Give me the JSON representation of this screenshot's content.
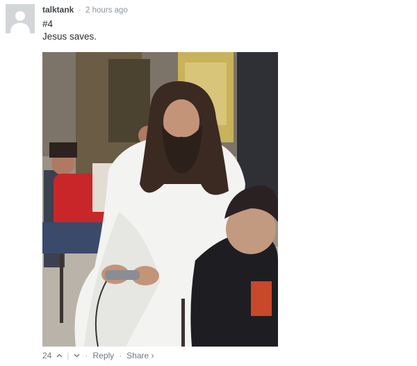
{
  "comment": {
    "author": "talktank",
    "separator": "·",
    "timestamp": "2 hours ago",
    "lines": [
      "#4",
      "Jesus saves."
    ],
    "image_alt_icon": "photo"
  },
  "footer": {
    "vote_count": "24",
    "upvote_icon": "chevron-up-icon",
    "downvote_icon": "chevron-down-icon",
    "pipe": "|",
    "dot": "·",
    "reply_label": "Reply",
    "share_label": "Share ›"
  }
}
